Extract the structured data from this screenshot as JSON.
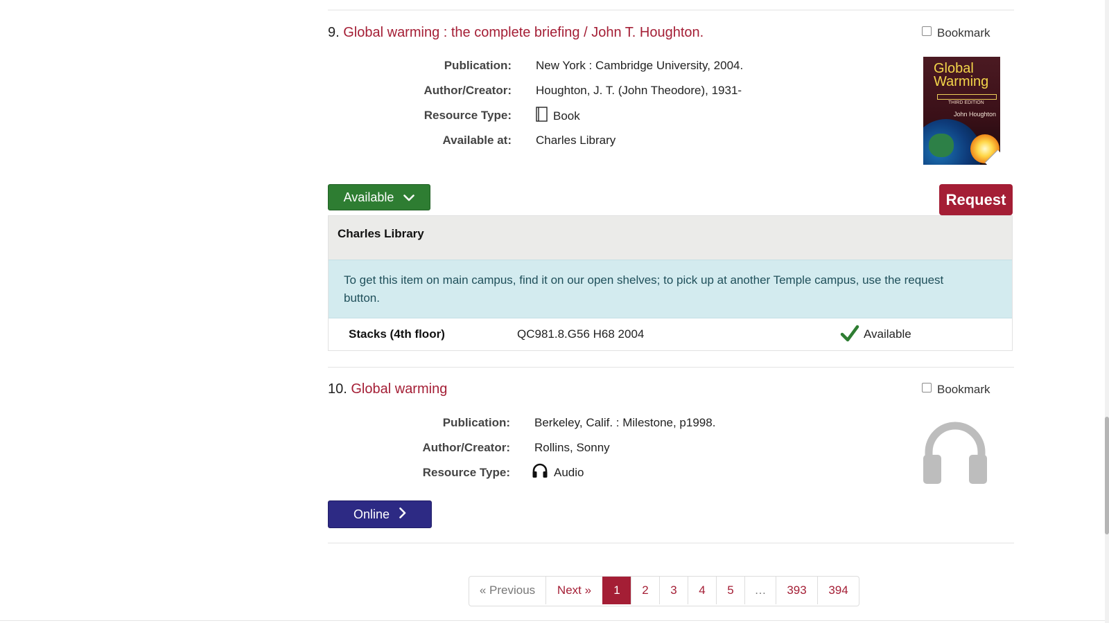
{
  "records": [
    {
      "number": "9.",
      "title": "Global warming : the complete briefing / John T. Houghton.",
      "bookmark_label": "Bookmark",
      "fields": {
        "publication_label": "Publication:",
        "publication": "New York : Cambridge University, 2004.",
        "author_label": "Author/Creator:",
        "author": "Houghton, J. T. (John Theodore), 1931-",
        "type_label": "Resource Type:",
        "type": "Book",
        "type_icon": "book-icon",
        "available_label": "Available at:",
        "available_at": "Charles Library"
      },
      "cover": {
        "title": "Global Warming",
        "edition": "THIRD EDITION",
        "author": "John Houghton"
      },
      "availability_button": "Available",
      "request_button": "Request",
      "holdings": {
        "library": "Charles Library",
        "note": "To get this item on main campus, find it on our open shelves; to pick up at another Temple campus, use the request button.",
        "location": "Stacks (4th floor)",
        "call_number": "QC981.8.G56 H68 2004",
        "status": "Available"
      }
    },
    {
      "number": "10.",
      "title": "Global warming",
      "bookmark_label": "Bookmark",
      "fields": {
        "publication_label": "Publication:",
        "publication": "Berkeley, Calif. : Milestone, p1998.",
        "author_label": "Author/Creator:",
        "author": "Rollins, Sonny",
        "type_label": "Resource Type:",
        "type": "Audio",
        "type_icon": "headphones-icon"
      },
      "thumbnail_icon": "headphones-icon",
      "online_button": "Online"
    }
  ],
  "pagination": {
    "previous": "« Previous",
    "next": "Next »",
    "pages": [
      "1",
      "2",
      "3",
      "4",
      "5",
      "…",
      "393",
      "394"
    ],
    "current": "1"
  },
  "colors": {
    "accent": "#a41e35",
    "available_green": "#2e7d32",
    "online_blue": "#2d2a84",
    "notice_bg": "#d3ebef",
    "check_green": "#2e7d32"
  }
}
